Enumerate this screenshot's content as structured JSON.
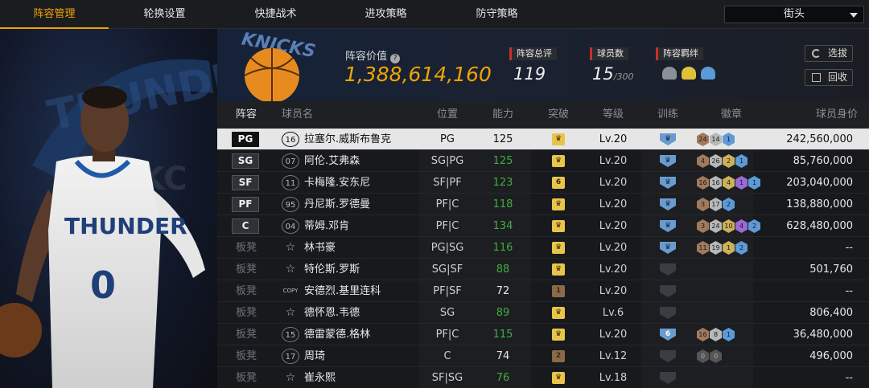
{
  "tabs": [
    {
      "label": "阵容管理",
      "active": true
    },
    {
      "label": "轮换设置",
      "active": false
    },
    {
      "label": "快捷战术",
      "active": false
    },
    {
      "label": "进攻策略",
      "active": false
    },
    {
      "label": "防守策略",
      "active": false
    }
  ],
  "mode_select": {
    "value": "街头"
  },
  "header": {
    "lineup_value_label": "阵容价值",
    "lineup_value": "1,388,614,160",
    "overall_label": "阵容总评",
    "overall_value": "119",
    "players_label": "球员数",
    "players_value": "15",
    "players_max": "/300",
    "bond_label": "阵容羁绊",
    "btn_select": "选拔",
    "btn_recycle": "回收",
    "art_text": "KNICKS"
  },
  "art": {
    "team_text": "THUNDER",
    "number": "0",
    "okc": "OKC"
  },
  "columns": [
    "阵容",
    "球员名",
    "位置",
    "能力",
    "突破",
    "等级",
    "训练",
    "徽章",
    "球员身价"
  ],
  "colors": {
    "accent": "#f0a400",
    "green": "#3fae3f",
    "red_bar": "#c8302a",
    "gold_badge": "#e8c54a"
  },
  "rows": [
    {
      "slot": "PG",
      "bench": false,
      "jersey": "16",
      "name": "拉塞尔.威斯布鲁克",
      "pos": "PG",
      "ovr": "125",
      "ovr_green": false,
      "brk": "crown",
      "lv": "Lv.20",
      "train": "crown-blue",
      "badges": [
        [
          "b",
          "24"
        ],
        [
          "s",
          "14"
        ],
        [
          "bl",
          "1"
        ]
      ],
      "value": "242,560,000",
      "selected": true
    },
    {
      "slot": "SG",
      "bench": false,
      "jersey": "07",
      "name": "阿伦.艾弗森",
      "pos": "SG|PG",
      "ovr": "125",
      "ovr_green": true,
      "brk": "crown",
      "lv": "Lv.20",
      "train": "crown-blue",
      "badges": [
        [
          "b",
          "4"
        ],
        [
          "s",
          "26"
        ],
        [
          "g",
          "2"
        ],
        [
          "bl",
          "1"
        ]
      ],
      "value": "85,760,000"
    },
    {
      "slot": "SF",
      "bench": false,
      "jersey": "11",
      "name": "卡梅隆.安东尼",
      "pos": "SF|PF",
      "ovr": "123",
      "ovr_green": true,
      "brk": "6",
      "lv": "Lv.20",
      "train": "crown-blue",
      "badges": [
        [
          "b",
          "16"
        ],
        [
          "s",
          "16"
        ],
        [
          "g",
          "4"
        ],
        [
          "p",
          "1"
        ],
        [
          "bl",
          "1"
        ]
      ],
      "value": "203,040,000"
    },
    {
      "slot": "PF",
      "bench": false,
      "jersey": "95",
      "name": "丹尼斯.罗德曼",
      "pos": "PF|C",
      "ovr": "118",
      "ovr_green": true,
      "brk": "crown",
      "lv": "Lv.20",
      "train": "crown-blue",
      "badges": [
        [
          "b",
          "3"
        ],
        [
          "s",
          "17"
        ],
        [
          "bl",
          "2"
        ]
      ],
      "value": "138,880,000"
    },
    {
      "slot": "C",
      "bench": false,
      "jersey": "04",
      "name": "蒂姆.邓肯",
      "pos": "PF|C",
      "ovr": "134",
      "ovr_green": true,
      "brk": "crown",
      "lv": "Lv.20",
      "train": "crown-blue",
      "badges": [
        [
          "b",
          "3"
        ],
        [
          "s",
          "24"
        ],
        [
          "g",
          "10"
        ],
        [
          "p",
          "4"
        ],
        [
          "bl",
          "2"
        ]
      ],
      "value": "628,480,000"
    },
    {
      "slot": "板凳",
      "bench": true,
      "jersey": "☆",
      "name": "林书豪",
      "pos": "PG|SG",
      "ovr": "116",
      "ovr_green": true,
      "brk": "crown",
      "lv": "Lv.20",
      "train": "crown-blue",
      "badges": [
        [
          "b",
          "11"
        ],
        [
          "s",
          "19"
        ],
        [
          "g",
          "1"
        ],
        [
          "bl",
          "2"
        ]
      ],
      "value": "--"
    },
    {
      "slot": "板凳",
      "bench": true,
      "jersey": "☆",
      "name": "特伦斯.罗斯",
      "pos": "SG|SF",
      "ovr": "88",
      "ovr_green": true,
      "brk": "crown",
      "lv": "Lv.20",
      "train": "dark",
      "badges": [],
      "value": "501,760"
    },
    {
      "slot": "板凳",
      "bench": true,
      "jersey": "COPY",
      "name": "安德烈.基里连科",
      "pos": "PF|SF",
      "ovr": "72",
      "ovr_green": false,
      "brk": "1",
      "lv": "Lv.20",
      "train": "dark",
      "badges": [],
      "value": "--"
    },
    {
      "slot": "板凳",
      "bench": true,
      "jersey": "☆",
      "name": "德怀恩.韦德",
      "pos": "SG",
      "ovr": "89",
      "ovr_green": true,
      "brk": "crown",
      "lv": "Lv.6",
      "train": "dark",
      "badges": [],
      "value": "806,400"
    },
    {
      "slot": "板凳",
      "bench": true,
      "jersey": "15",
      "name": "德雷蒙德.格林",
      "pos": "PF|C",
      "ovr": "115",
      "ovr_green": true,
      "brk": "crown",
      "lv": "Lv.20",
      "train": "6",
      "badges": [
        [
          "b",
          "16"
        ],
        [
          "s",
          "8"
        ],
        [
          "bl",
          "1"
        ]
      ],
      "value": "36,480,000"
    },
    {
      "slot": "板凳",
      "bench": true,
      "jersey": "17",
      "name": "周琦",
      "pos": "C",
      "ovr": "74",
      "ovr_green": false,
      "brk": "2",
      "lv": "Lv.12",
      "train": "dark",
      "badges": [
        [
          "d",
          "0"
        ],
        [
          "d",
          "0"
        ]
      ],
      "value": "496,000"
    },
    {
      "slot": "板凳",
      "bench": true,
      "jersey": "☆",
      "name": "崔永熙",
      "pos": "SF|SG",
      "ovr": "76",
      "ovr_green": true,
      "brk": "crown",
      "lv": "Lv.18",
      "train": "dark",
      "badges": [],
      "value": "--"
    }
  ]
}
